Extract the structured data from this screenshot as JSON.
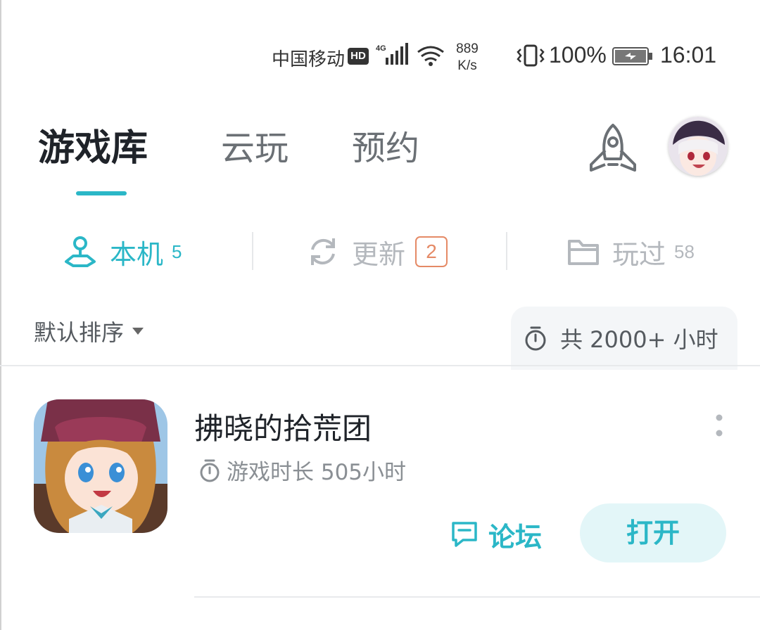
{
  "status_bar": {
    "carrier": "中国移动",
    "hd_badge": "HD",
    "network_type": "4G",
    "speed_value": "889",
    "speed_unit": "K/s",
    "battery_percent": "100%",
    "time": "16:01",
    "icons": [
      "signal-icon",
      "wifi-icon",
      "vibrate-icon",
      "battery-charging-icon"
    ]
  },
  "top_tabs": [
    {
      "label": "游戏库",
      "active": true
    },
    {
      "label": "云玩",
      "active": false
    },
    {
      "label": "预约",
      "active": false
    }
  ],
  "header_icons": {
    "rocket": "rocket-icon",
    "avatar": "avatar"
  },
  "sub_tabs": {
    "local": {
      "label": "本机",
      "count": "5",
      "icon": "local-device-icon"
    },
    "update": {
      "label": "更新",
      "badge": "2",
      "icon": "refresh-icon"
    },
    "played": {
      "label": "玩过",
      "count": "58",
      "icon": "folder-icon"
    }
  },
  "sort": {
    "label": "默认排序"
  },
  "total_time": {
    "label": "共 2000+ 小时",
    "icon": "timer-icon"
  },
  "games": [
    {
      "title": "拂晓的拾荒团",
      "playtime": "游戏时长 505小时",
      "forum_label": "论坛",
      "open_label": "打开"
    }
  ],
  "colors": {
    "accent": "#2bb7c7",
    "badge": "#e58a66",
    "open_button_bg": "#e3f6f8",
    "muted": "#b4b8bd"
  }
}
